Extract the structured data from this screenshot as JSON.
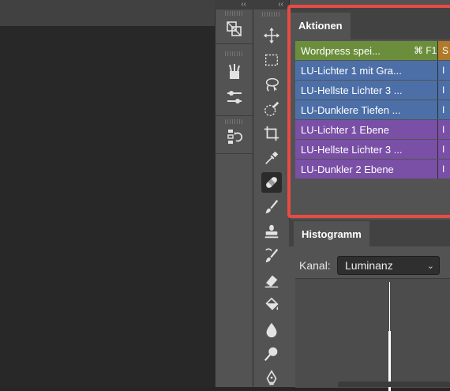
{
  "dock": {
    "collapse_glyph": "‹‹",
    "icons": [
      "layers-transform-icon",
      "brushes-icon",
      "adjustments-icon",
      "history-icon"
    ]
  },
  "toolbar": {
    "collapse_glyph": "‹‹",
    "tools": [
      {
        "name": "move-tool-icon",
        "active": false
      },
      {
        "name": "marquee-tool-icon",
        "active": false
      },
      {
        "name": "lasso-tool-icon",
        "active": false
      },
      {
        "name": "quick-selection-tool-icon",
        "active": false
      },
      {
        "name": "crop-tool-icon",
        "active": false
      },
      {
        "name": "eyedropper-tool-icon",
        "active": false
      },
      {
        "name": "healing-brush-tool-icon",
        "active": true
      },
      {
        "name": "brush-tool-icon",
        "active": false
      },
      {
        "name": "clone-stamp-tool-icon",
        "active": false
      },
      {
        "name": "history-brush-tool-icon",
        "active": false
      },
      {
        "name": "eraser-tool-icon",
        "active": false
      },
      {
        "name": "paint-bucket-tool-icon",
        "active": false
      },
      {
        "name": "blur-tool-icon",
        "active": false
      },
      {
        "name": "dodge-tool-icon",
        "active": false
      },
      {
        "name": "pen-tool-icon",
        "active": false
      }
    ]
  },
  "actions_panel": {
    "tab_label": "Aktionen",
    "rows": [
      {
        "name": "Wordpress spei...",
        "key": "⌘ F1",
        "next": "S",
        "color": "#6b8e3c",
        "next_color": "#b07a2a"
      },
      {
        "name": "LU-Lichter 1 mit Gra...",
        "key": "",
        "next": "I",
        "color": "#4d6fa8",
        "next_color": "#4d6fa8"
      },
      {
        "name": "LU-Hellste Lichter 3 ...",
        "key": "",
        "next": "I",
        "color": "#4d6fa8",
        "next_color": "#4d6fa8"
      },
      {
        "name": "LU-Dunklere Tiefen ...",
        "key": "",
        "next": "I",
        "color": "#4d6fa8",
        "next_color": "#4d6fa8"
      },
      {
        "name": "LU-Lichter 1 Ebene",
        "key": "",
        "next": "I",
        "color": "#7a4fa6",
        "next_color": "#7a4fa6"
      },
      {
        "name": "LU-Hellste Lichter 3 ...",
        "key": "",
        "next": "I",
        "color": "#7a4fa6",
        "next_color": "#7a4fa6"
      },
      {
        "name": "LU-Dunkler 2 Ebene",
        "key": "",
        "next": "I",
        "color": "#7a4fa6",
        "next_color": "#7a4fa6"
      }
    ]
  },
  "histogram_panel": {
    "tab_label": "Histogramm",
    "channel_label": "Kanal:",
    "channel_value": "Luminanz"
  },
  "colors": {
    "highlight": "#e84b43",
    "panel_bg": "#535353"
  }
}
